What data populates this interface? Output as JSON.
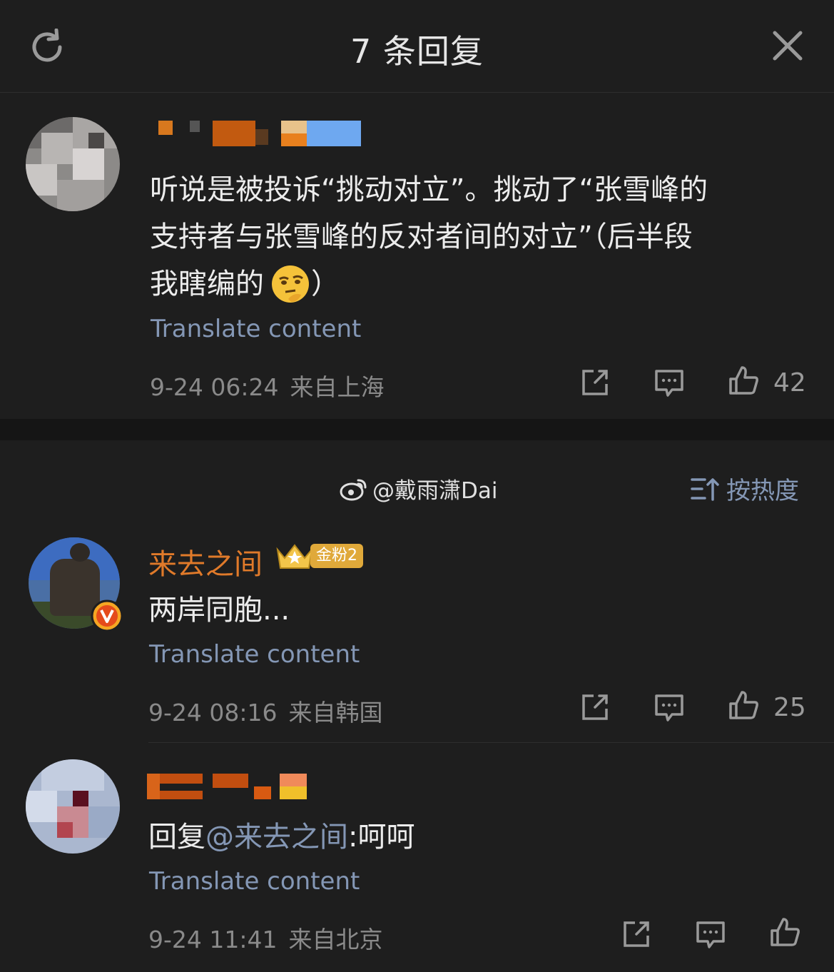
{
  "header": {
    "title": "7 条回复",
    "refresh_icon": "refresh-icon",
    "close_icon": "close-icon"
  },
  "root_comment": {
    "text_line1": "听说是被投诉“挑动对立”。挑动了“张雪峰的",
    "text_line2": "支持者与张雪峰的反对者间的对立”（后半段",
    "text_line3": "我瞎编的",
    "text_line3_end": "）",
    "translate": "Translate content",
    "date": "9-24 06:24",
    "location": "来自上海",
    "likes": "42"
  },
  "replies_header": {
    "source": "@戴雨潇Dai",
    "sort_label": "按热度"
  },
  "replies": [
    {
      "name": "来去之间",
      "badge": "金粉2",
      "text": "两岸同胞...",
      "translate": "Translate content",
      "date": "9-24 08:16",
      "location": "来自韩国",
      "likes": "25"
    },
    {
      "reply_prefix": "回复",
      "mention": "@来去之间",
      "text": ":呵呵",
      "translate": "Translate content",
      "date": "9-24 11:41",
      "location": "来自北京"
    }
  ],
  "colors": {
    "background": "#1e1e1e",
    "link": "#8497b5",
    "username": "#e07a2a",
    "meta": "#8a8a8a"
  }
}
